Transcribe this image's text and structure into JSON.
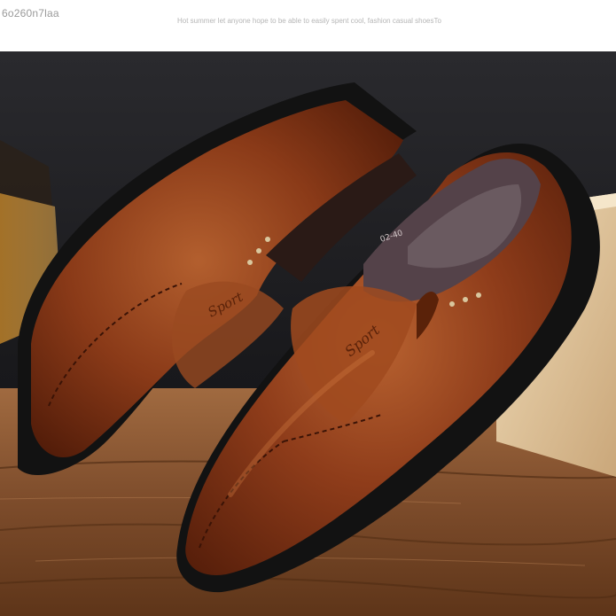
{
  "header": {
    "watermark_id": "6o260n7laa",
    "tagline": "Hot summer let anyone hope to be able to easily spent cool, fashion casual shoesTo"
  },
  "photo": {
    "subject": "brown-leather-slip-on-loafers",
    "colors": {
      "leather": "#7a2f14",
      "leather_highlight": "#b05a2c",
      "sole": "#141414",
      "lining": "#5a4b4f",
      "wood": "#8b5a36",
      "box": "#e2c9a4",
      "backdrop": "#1b1b1f"
    },
    "size_label": "02-40",
    "logo_text": "Sport"
  }
}
